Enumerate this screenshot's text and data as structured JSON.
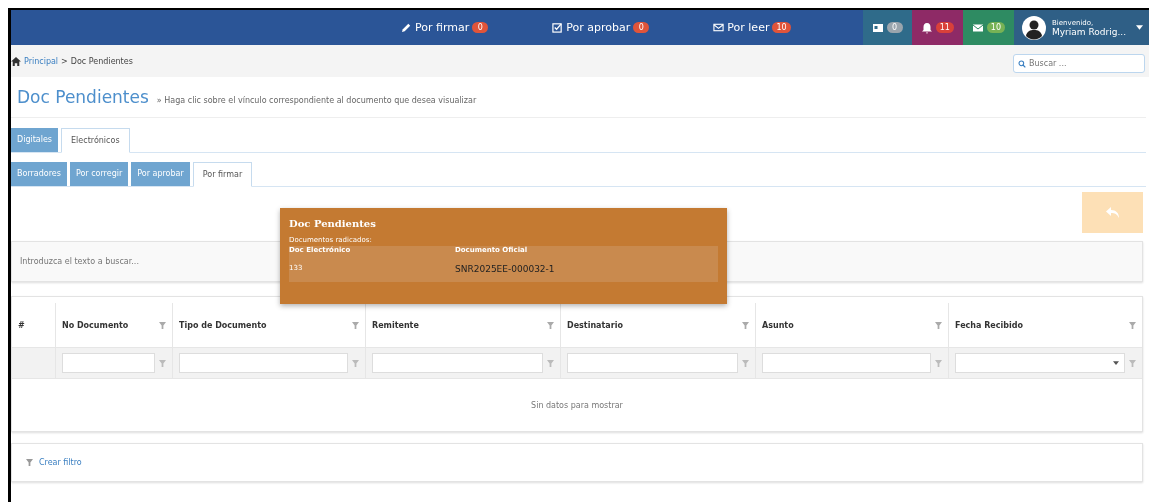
{
  "navbar": {
    "links": [
      {
        "label": "Por firmar",
        "count": "0"
      },
      {
        "label": "Por aprobar",
        "count": "0"
      },
      {
        "label": "Por leer",
        "count": "10"
      }
    ],
    "notifications": [
      {
        "count": "0",
        "color": "#2f6b8a"
      },
      {
        "count": "11",
        "color": "#8e2a66"
      },
      {
        "count": "10",
        "color": "#2e8b62"
      }
    ],
    "user": {
      "greeting": "Bienvenido,",
      "name": "Myriam Rodrig..."
    }
  },
  "breadcrumb": {
    "items": [
      "Principal",
      "Doc Pendientes"
    ],
    "separator": ">"
  },
  "search": {
    "placeholder": "Buscar ..."
  },
  "page_title": {
    "title": "Doc Pendientes",
    "subtitle": "» Haga clic sobre el vínculo correspondiente al documento que desea visualizar"
  },
  "tabs": [
    {
      "label": "Digitales",
      "selected": false
    },
    {
      "label": "Electrónicos",
      "selected": true
    }
  ],
  "subtabs": [
    {
      "label": "Borradores",
      "selected": false
    },
    {
      "label": "Por corregir",
      "selected": false
    },
    {
      "label": "Por aprobar",
      "selected": false
    },
    {
      "label": "Por firmar",
      "selected": true
    }
  ],
  "grid_search": {
    "placeholder": "Introduzca el texto a buscar..."
  },
  "table": {
    "columns": [
      {
        "label": "#",
        "kind": "index"
      },
      {
        "label": "No Documento",
        "kind": "text"
      },
      {
        "label": "Tipo de Documento",
        "kind": "text"
      },
      {
        "label": "Remitente",
        "kind": "text"
      },
      {
        "label": "Destinatario",
        "kind": "text"
      },
      {
        "label": "Asunto",
        "kind": "text"
      },
      {
        "label": "Fecha Recibido",
        "kind": "date"
      }
    ],
    "empty_text": "Sin datos para mostrar"
  },
  "filter_link": "Crear filtro",
  "popup": {
    "title": "Doc Pendientes",
    "subtitle": "Documentos radicados:",
    "columns": [
      "Doc Electrónico",
      "Documento Oficial"
    ],
    "rows": [
      [
        "133",
        "SNR2025EE-000032-1"
      ]
    ]
  }
}
